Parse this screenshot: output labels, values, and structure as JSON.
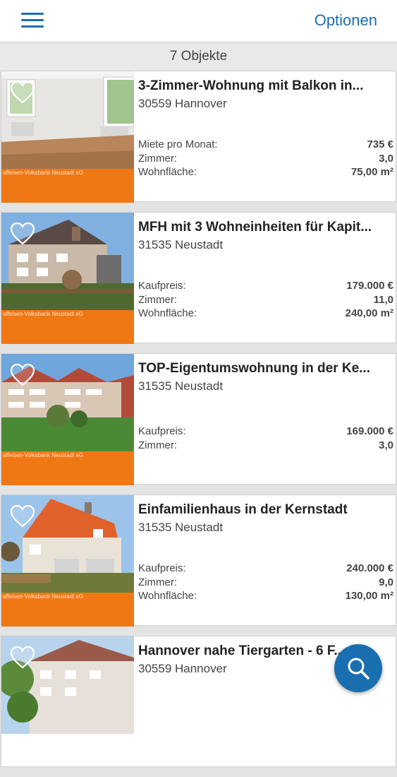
{
  "header": {
    "options_label": "Optionen"
  },
  "count_label": "7 Objekte",
  "bank_label": "affeisen-Volksbank Neustadt eG",
  "colors": {
    "accent": "#1a6fb0",
    "bank_band": "#f07814"
  },
  "listings": [
    {
      "title": "3-Zimmer-Wohnung mit Balkon in...",
      "location": "30559 Hannover",
      "rows": [
        {
          "label": "Miete pro Monat:",
          "value": "735 €"
        },
        {
          "label": "Zimmer:",
          "value": "3,0"
        },
        {
          "label": "Wohnfläche:",
          "value": "75,00 m²"
        }
      ]
    },
    {
      "title": "MFH mit 3 Wohneinheiten für Kapit...",
      "location": "31535 Neustadt",
      "rows": [
        {
          "label": "Kaufpreis:",
          "value": "179.000 €"
        },
        {
          "label": "Zimmer:",
          "value": "11,0"
        },
        {
          "label": "Wohnfläche:",
          "value": "240,00 m²"
        }
      ]
    },
    {
      "title": "TOP-Eigentumswohnung in der Ke...",
      "location": "31535 Neustadt",
      "rows": [
        {
          "label": "Kaufpreis:",
          "value": "169.000 €"
        },
        {
          "label": "Zimmer:",
          "value": "3,0"
        }
      ]
    },
    {
      "title": "Einfamilienhaus in der Kernstadt",
      "location": "31535 Neustadt",
      "rows": [
        {
          "label": "Kaufpreis:",
          "value": "240.000 €"
        },
        {
          "label": "Zimmer:",
          "value": "9,0"
        },
        {
          "label": "Wohnfläche:",
          "value": "130,00 m²"
        }
      ]
    },
    {
      "title": "Hannover nahe Tiergarten - 6 F...",
      "location": "30559 Hannover",
      "rows": []
    }
  ]
}
